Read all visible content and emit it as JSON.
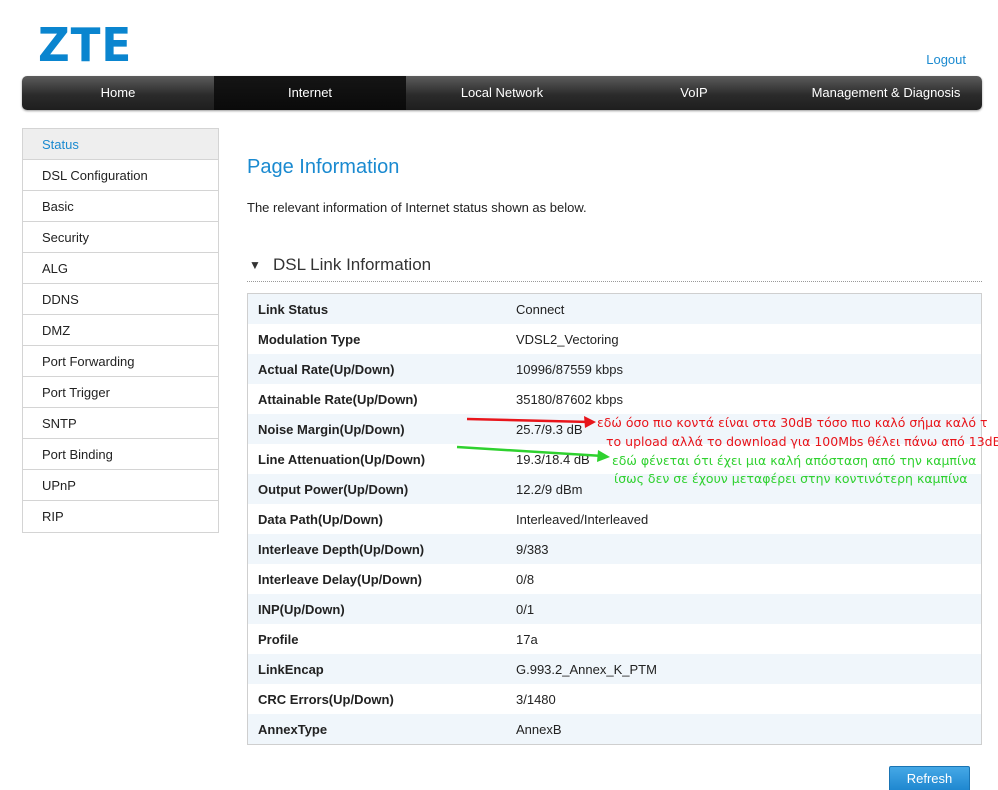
{
  "brand": {
    "logo_text": "ZTE",
    "color": "#0a85cf"
  },
  "header": {
    "logout_label": "Logout"
  },
  "nav": {
    "items": [
      {
        "label": "Home"
      },
      {
        "label": "Internet"
      },
      {
        "label": "Local Network"
      },
      {
        "label": "VoIP"
      },
      {
        "label": "Management & Diagnosis"
      }
    ],
    "active_index": 1
  },
  "sidebar": {
    "items": [
      {
        "label": "Status"
      },
      {
        "label": "DSL Configuration"
      },
      {
        "label": "Basic"
      },
      {
        "label": "Security"
      },
      {
        "label": "ALG"
      },
      {
        "label": "DDNS"
      },
      {
        "label": "DMZ"
      },
      {
        "label": "Port Forwarding"
      },
      {
        "label": "Port Trigger"
      },
      {
        "label": "SNTP"
      },
      {
        "label": "Port Binding"
      },
      {
        "label": "UPnP"
      },
      {
        "label": "RIP"
      }
    ],
    "active_index": 0
  },
  "main": {
    "title": "Page Information",
    "description": "The relevant information of Internet status shown as below.",
    "section": {
      "arrow": "▼",
      "title": "DSL Link Information"
    },
    "rows": [
      {
        "label": "Link Status",
        "value": "Connect"
      },
      {
        "label": "Modulation Type",
        "value": "VDSL2_Vectoring"
      },
      {
        "label": "Actual Rate(Up/Down)",
        "value": "10996/87559 kbps"
      },
      {
        "label": "Attainable Rate(Up/Down)",
        "value": "35180/87602 kbps"
      },
      {
        "label": "Noise Margin(Up/Down)",
        "value": "25.7/9.3 dB"
      },
      {
        "label": "Line Attenuation(Up/Down)",
        "value": "19.3/18.4 dB"
      },
      {
        "label": "Output Power(Up/Down)",
        "value": "12.2/9 dBm"
      },
      {
        "label": "Data Path(Up/Down)",
        "value": "Interleaved/Interleaved"
      },
      {
        "label": "Interleave Depth(Up/Down)",
        "value": "9/383"
      },
      {
        "label": "Interleave Delay(Up/Down)",
        "value": "0/8"
      },
      {
        "label": "INP(Up/Down)",
        "value": "0/1"
      },
      {
        "label": "Profile",
        "value": "17a"
      },
      {
        "label": "LinkEncap",
        "value": "G.993.2_Annex_K_PTM"
      },
      {
        "label": "CRC Errors(Up/Down)",
        "value": "3/1480"
      },
      {
        "label": "AnnexType",
        "value": "AnnexB"
      }
    ],
    "refresh_label": "Refresh"
  },
  "annotations": {
    "red_line1": "εδώ όσο πιο κοντά είναι στα 30dB τόσο πιο καλό σήμα καλό τ",
    "red_line2": "το upload αλλά το download για 100Mbs θέλει πάνω από 13dB",
    "green_line1": "εδώ φένεται ότι έχει μια καλή απόσταση από την καμπίνα",
    "green_line2": "ίσως δεν σε έχουν μεταφέρει στην κοντινότερη καμπίνα",
    "red_color": "#e8151b",
    "green_color": "#2fd12f"
  }
}
